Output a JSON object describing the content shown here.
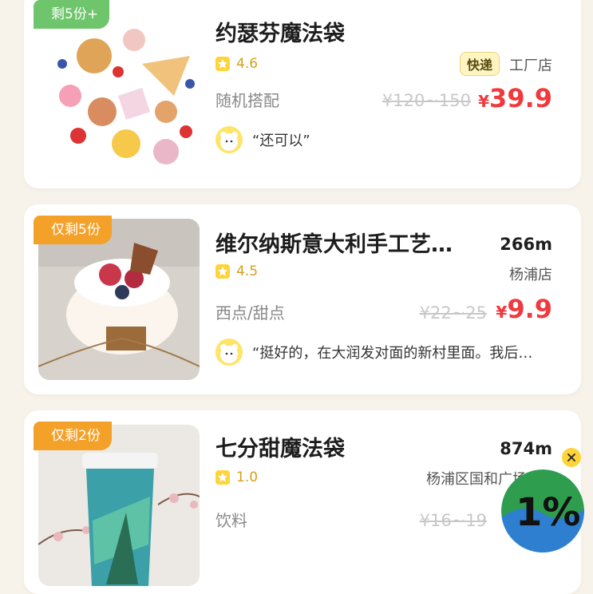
{
  "cards": [
    {
      "badge": "剩5份+",
      "title": "约瑟芬魔法袋",
      "rating": "4.6",
      "category": "随机搭配",
      "delivery_tag": "快递",
      "store": "工厂店",
      "original_price": "¥120~150",
      "price_symbol": "¥",
      "price": "39.9",
      "review": "“还可以”"
    },
    {
      "badge": "仅剩5份",
      "title": "维尔纳斯意大利手工艺…",
      "distance": "266m",
      "rating": "4.5",
      "category": "西点/甜点",
      "store": "杨浦店",
      "original_price": "¥22~25",
      "price_symbol": "¥",
      "price": "9.9",
      "review": "“挺好的，在大润发对面的新村里面。我后…"
    },
    {
      "badge": "仅剩2份",
      "title": "七分甜魔法袋",
      "distance": "874m",
      "rating": "1.0",
      "category": "饮料",
      "store": "杨浦区国和广场店",
      "original_price": "¥16~19"
    }
  ],
  "floating_badge": {
    "text": "1%",
    "close_icon": "close-icon"
  },
  "colors": {
    "background": "#f7f3ea",
    "accent_green": "#6ec56b",
    "accent_orange": "#f4a12a",
    "price_red": "#f0393d",
    "rating_gold": "#d5a01b"
  }
}
